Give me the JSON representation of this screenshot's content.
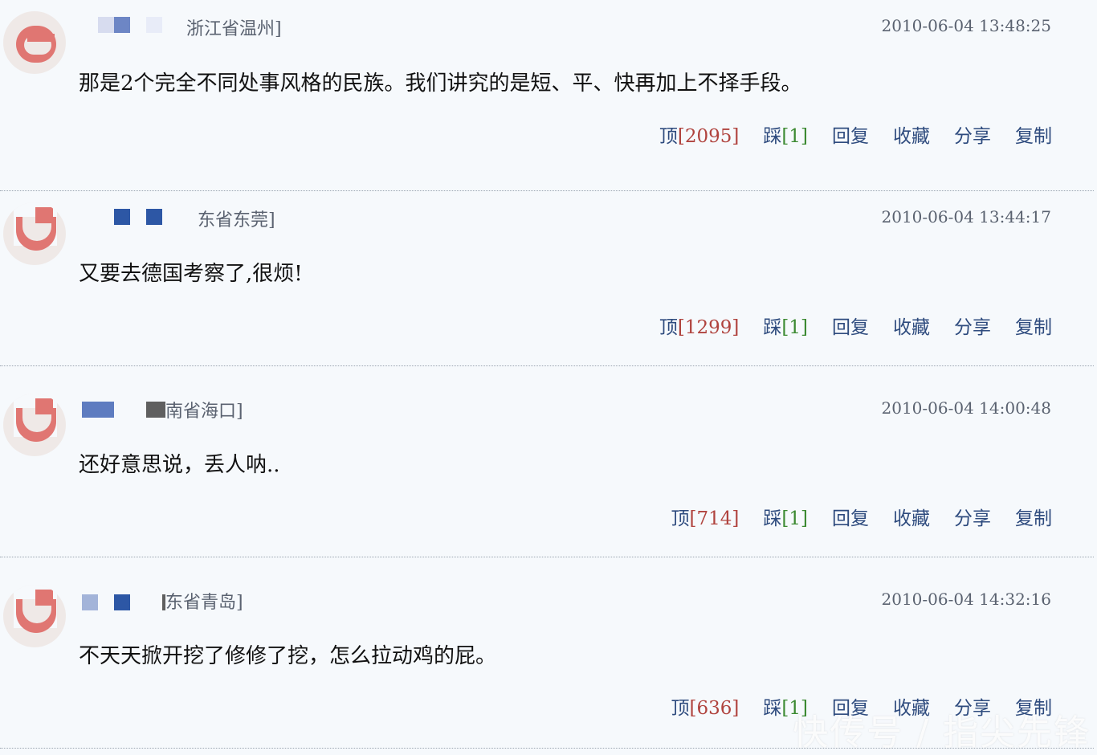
{
  "comments": [
    {
      "location": "浙江省温州]",
      "timestamp": "2010-06-04 13:48:25",
      "text": "那是2个完全不同处事风格的民族。我们讲究的是短、平、快再加上不择手段。",
      "actions": {
        "up_label": "顶",
        "up_count": "[2095]",
        "down_label": "踩",
        "down_count": "[1]",
        "reply": "回复",
        "collect": "收藏",
        "share": "分享",
        "copy": "复制"
      }
    },
    {
      "location": "东省东莞]",
      "timestamp": "2010-06-04 13:44:17",
      "text": "又要去德国考察了,很烦!",
      "actions": {
        "up_label": "顶",
        "up_count": "[1299]",
        "down_label": "踩",
        "down_count": "[1]",
        "reply": "回复",
        "collect": "收藏",
        "share": "分享",
        "copy": "复制"
      }
    },
    {
      "location": "南省海口]",
      "timestamp": "2010-06-04 14:00:48",
      "text": "还好意思说，丢人呐..",
      "actions": {
        "up_label": "顶",
        "up_count": "[714]",
        "down_label": "踩",
        "down_count": "[1]",
        "reply": "回复",
        "collect": "收藏",
        "share": "分享",
        "copy": "复制"
      }
    },
    {
      "location": "东省青岛]",
      "timestamp": "2010-06-04 14:32:16",
      "text": "不天天掀开挖了修修了挖，怎么拉动鸡的屁。",
      "actions": {
        "up_label": "顶",
        "up_count": "[636]",
        "down_label": "踩",
        "down_count": "[1]",
        "reply": "回复",
        "collect": "收藏",
        "share": "分享",
        "copy": "复制"
      }
    }
  ],
  "watermark": "快传号 / 指尖先锋",
  "colors": {
    "background": "#f6f9fc",
    "link": "#2e4b7e",
    "up_count": "#b0433e",
    "down_count": "#3c8a32",
    "avatar_accent": "#e07672"
  }
}
